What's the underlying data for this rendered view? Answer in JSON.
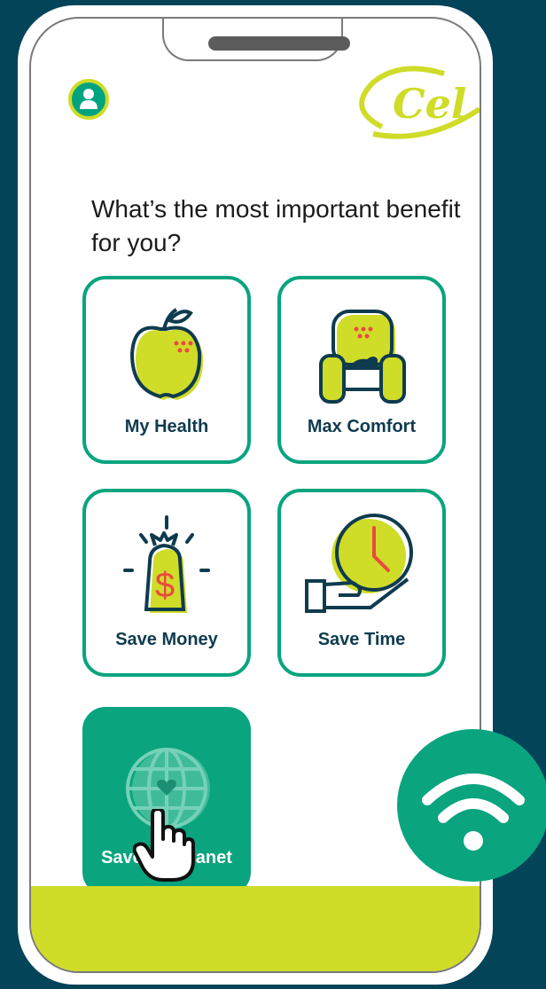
{
  "question": "What’s the most important benefit for you?",
  "options": [
    {
      "label": "My Health"
    },
    {
      "label": "Max Comfort"
    },
    {
      "label": "Save Money"
    },
    {
      "label": "Save Time"
    },
    {
      "label": "Save the Planet",
      "selected": true
    }
  ],
  "logo_text": "Cel",
  "colors": {
    "background": "#034459",
    "accent_green": "#0aa47f",
    "lime": "#cfdc28",
    "navy": "#0f3b4e",
    "red": "#ea4a40"
  },
  "icons": [
    "user-icon",
    "apple-icon",
    "armchair-icon",
    "money-bag-icon",
    "clock-hand-icon",
    "globe-heart-icon",
    "hand-pointer-icon",
    "wifi-icon"
  ]
}
